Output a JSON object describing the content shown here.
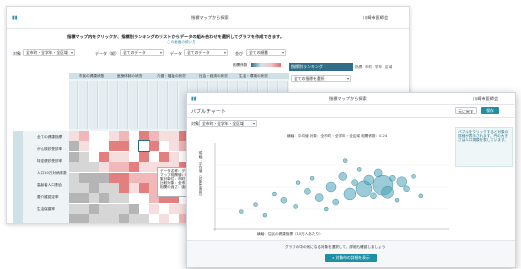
{
  "back": {
    "title": "指標マップから探索",
    "org": "川崎市医師会",
    "instruction": "指標マップ内をクリックか、指標別ランキングのリストからデータの組み合わせを選択してグラフを作成できます。",
    "help_link": "この画面の使い方",
    "filters": [
      {
        "label": "対象",
        "value": "全市町・全学年・全区域"
      },
      {
        "label": "データ（縦）",
        "value": "全てのデータ"
      },
      {
        "label": "データ（横）",
        "value": "全てのデータ"
      },
      {
        "label": "並び",
        "value": "全ての順番"
      }
    ],
    "legend": {
      "left": "相関係数",
      "ticks": [
        "-1.0",
        "0",
        "1.0"
      ]
    },
    "ranking_title": "指標別ランキング",
    "ranking_tabs": [
      "指標",
      "市町",
      "学年",
      "区域"
    ],
    "ranking_select": "全ての指標を選択",
    "col_headers": [
      "市民の健康状態",
      "医療体制の状況",
      "介護・福祉の状況",
      "社会・経済の状況",
      "生活・環境の状況"
    ],
    "row_labels": [
      "全ての健康指標",
      "がん検診受診率",
      "特定健診受診率",
      "人口10万対病床数",
      "高齢者人口割合",
      "要介護認定率",
      "生活保護率"
    ],
    "tooltip": [
      "データ名称：データ項目",
      "マップ相関値：0.62",
      "集計単位：市町",
      "比較対象：全市",
      "相関の強さ：強い"
    ]
  },
  "front": {
    "title": "指標マップから探索",
    "org": "川崎市医師会",
    "section": "バブルチャート",
    "btn_secondary": "元に戻す",
    "btn_primary": "保存",
    "target_label": "対象",
    "target_value": "全市町・全学年・全区域",
    "chart_caption": "横軸：平均値 対象：全市町・全学年・全区域 相関係数：0.24",
    "y_label": "縦軸：平均値（対象年度別）",
    "x_label": "横軸：住民の健康指標（10万人あたり）",
    "side_note": "バブルをクリックすると対象の詳細が表示されます。円の大きさは人口規模を表しています。",
    "bottom_text": "グラフの中の気になる対象を選択して、詳細も確認しましょう",
    "bottom_button": "対象市の詳細を表示"
  },
  "chart_data": {
    "type": "scatter",
    "title": "横軸：平均値 対象：全市町・全学年・全区域 相関係数：0.24",
    "xlabel": "横軸：住民の健康指標（10万人あたり）",
    "ylabel": "縦軸：平均値（対象年度別）",
    "points": [
      {
        "x": 0.12,
        "y": 0.22,
        "r": 2
      },
      {
        "x": 0.18,
        "y": 0.3,
        "r": 2
      },
      {
        "x": 0.22,
        "y": 0.18,
        "r": 2
      },
      {
        "x": 0.3,
        "y": 0.35,
        "r": 3
      },
      {
        "x": 0.35,
        "y": 0.28,
        "r": 2
      },
      {
        "x": 0.4,
        "y": 0.45,
        "r": 3
      },
      {
        "x": 0.42,
        "y": 0.6,
        "r": 2
      },
      {
        "x": 0.45,
        "y": 0.38,
        "r": 4
      },
      {
        "x": 0.5,
        "y": 0.5,
        "r": 5
      },
      {
        "x": 0.52,
        "y": 0.33,
        "r": 3
      },
      {
        "x": 0.55,
        "y": 0.62,
        "r": 4
      },
      {
        "x": 0.58,
        "y": 0.42,
        "r": 6
      },
      {
        "x": 0.6,
        "y": 0.55,
        "r": 3
      },
      {
        "x": 0.62,
        "y": 0.7,
        "r": 2
      },
      {
        "x": 0.64,
        "y": 0.48,
        "r": 8
      },
      {
        "x": 0.66,
        "y": 0.58,
        "r": 5
      },
      {
        "x": 0.68,
        "y": 0.4,
        "r": 3
      },
      {
        "x": 0.7,
        "y": 0.66,
        "r": 4
      },
      {
        "x": 0.72,
        "y": 0.52,
        "r": 10
      },
      {
        "x": 0.74,
        "y": 0.44,
        "r": 6
      },
      {
        "x": 0.76,
        "y": 0.6,
        "r": 3
      },
      {
        "x": 0.78,
        "y": 0.35,
        "r": 2
      },
      {
        "x": 0.8,
        "y": 0.56,
        "r": 5
      },
      {
        "x": 0.82,
        "y": 0.48,
        "r": 3
      },
      {
        "x": 0.85,
        "y": 0.62,
        "r": 2
      },
      {
        "x": 0.88,
        "y": 0.4,
        "r": 2
      },
      {
        "x": 0.48,
        "y": 0.25,
        "r": 2
      },
      {
        "x": 0.36,
        "y": 0.55,
        "r": 2
      },
      {
        "x": 0.26,
        "y": 0.42,
        "r": 2
      },
      {
        "x": 0.56,
        "y": 0.8,
        "r": 2
      }
    ]
  },
  "colors": {
    "accent": "#1f8fa6",
    "dark": "#2f6e86",
    "neg": "#e06b6b",
    "bubble": "#4aa3b8"
  }
}
